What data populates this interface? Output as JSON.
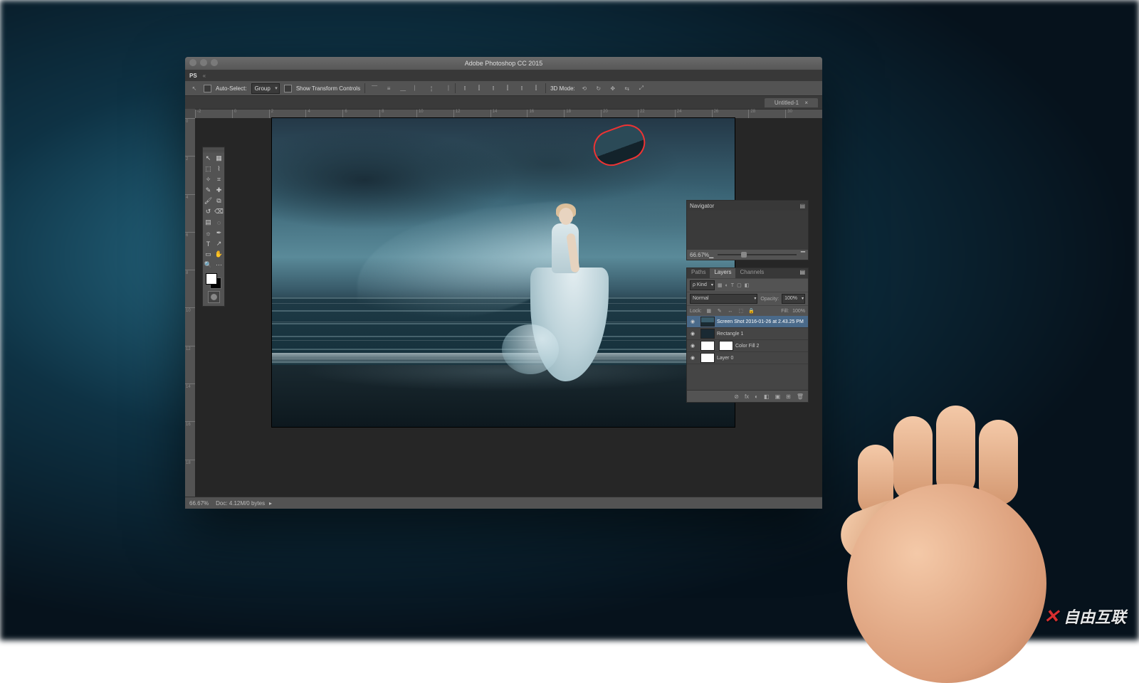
{
  "watermark": "自由互联",
  "window": {
    "title": "Adobe Photoshop CC 2015"
  },
  "menubar": {
    "home_icon": "PS"
  },
  "options_bar": {
    "auto_select_label": "Auto-Select:",
    "auto_select_value": "Group",
    "show_transform_label": "Show Transform Controls",
    "mode_label": "3D Mode:"
  },
  "document_tab": {
    "label": "Untitled-1"
  },
  "ruler_marks": [
    "-2",
    "0",
    "2",
    "4",
    "6",
    "8",
    "10",
    "12",
    "14",
    "16",
    "18",
    "20",
    "22",
    "24",
    "26",
    "28",
    "30"
  ],
  "ruler_marks_v": [
    "0",
    "2",
    "4",
    "6",
    "8",
    "10",
    "12",
    "14",
    "16",
    "18"
  ],
  "toolbox": {
    "tools": [
      [
        "move",
        "artboard"
      ],
      [
        "marquee",
        "lasso"
      ],
      [
        "quick-select",
        "crop"
      ],
      [
        "eyedropper",
        "spot-heal"
      ],
      [
        "brush",
        "clone"
      ],
      [
        "history-brush",
        "eraser"
      ],
      [
        "gradient",
        "blur"
      ],
      [
        "dodge",
        "pen"
      ],
      [
        "type",
        "path-select"
      ],
      [
        "rectangle",
        "hand"
      ],
      [
        "zoom",
        "edit-toolbar"
      ]
    ],
    "glyphs": [
      [
        "↖",
        "▦"
      ],
      [
        "⬚",
        "⌇"
      ],
      [
        "✧",
        "⌗"
      ],
      [
        "✎",
        "✚"
      ],
      [
        "🖌",
        "⧉"
      ],
      [
        "↺",
        "⌫"
      ],
      [
        "▤",
        "◌"
      ],
      [
        "☼",
        "✒"
      ],
      [
        "T",
        "↗"
      ],
      [
        "▭",
        "✋"
      ],
      [
        "🔍",
        "⋯"
      ]
    ]
  },
  "navigator": {
    "title": "Navigator",
    "zoom": "66.67%",
    "zoom_out": "▁",
    "zoom_in": "▔"
  },
  "layers_panel": {
    "tabs": [
      "Paths",
      "Layers",
      "Channels"
    ],
    "kind_label": "ρ Kind",
    "filter_icons": [
      "▦",
      "◐",
      "T",
      "▢",
      "◧"
    ],
    "blend_mode": "Normal",
    "opacity_label": "Opacity:",
    "opacity_value": "100%",
    "lock_label": "Lock:",
    "lock_icons": [
      "▦",
      "✎",
      "↔",
      "⬚",
      "🔒"
    ],
    "fill_label": "Fill:",
    "fill_value": "100%",
    "layers": [
      {
        "name": "Screen Shot 2016-01-26 at 2.43.25 PM",
        "visible": true,
        "thumb": "img",
        "selected": true,
        "mask": false
      },
      {
        "name": "Rectangle 1",
        "visible": true,
        "thumb": "dark",
        "selected": false,
        "mask": false
      },
      {
        "name": "Color Fill 2",
        "visible": true,
        "thumb": "wht",
        "selected": false,
        "mask": true
      },
      {
        "name": "Layer 0",
        "visible": true,
        "thumb": "wht",
        "selected": false,
        "mask": false
      }
    ],
    "footer_icons": [
      "⊘",
      "fx",
      "◐",
      "◧",
      "▣",
      "⊞",
      "🗑"
    ]
  },
  "statusbar": {
    "zoom": "66.67%",
    "doc_info": "Doc: 4.12M/0 bytes"
  }
}
